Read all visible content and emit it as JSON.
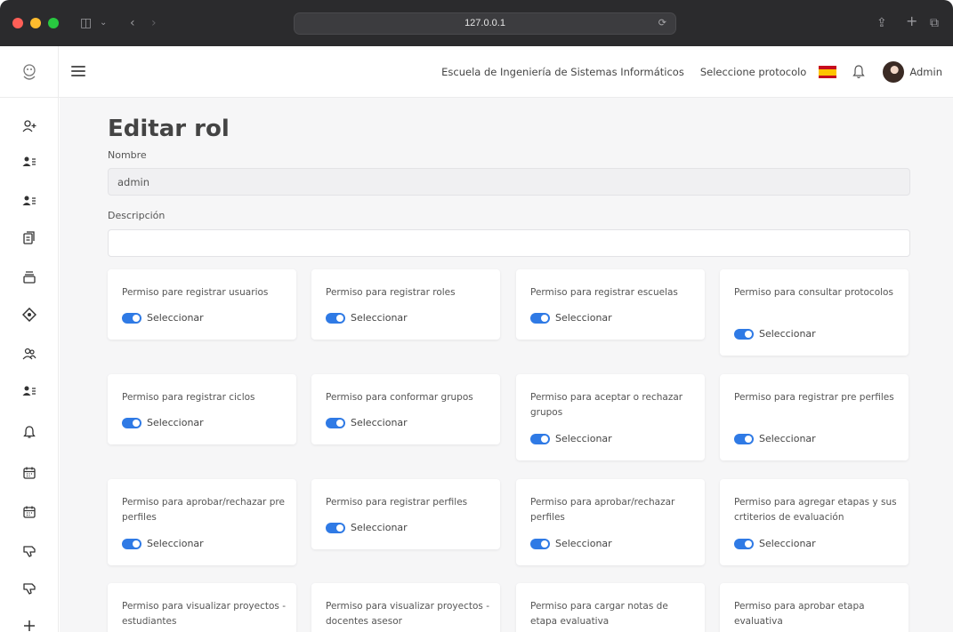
{
  "browser": {
    "url": "127.0.0.1"
  },
  "header": {
    "school": "Escuela de Ingeniería de Sistemas Informáticos",
    "protocol": "Seleccione protocolo",
    "user": "Admin"
  },
  "sidebar": {
    "icons": [
      "add-user-icon",
      "user-list-icon",
      "user-list-icon",
      "document-icon",
      "box-icon",
      "diamond-icon",
      "users-icon",
      "user-list-icon",
      "bell-icon",
      "calendar-icon",
      "calendar-icon",
      "thumb-down-icon",
      "thumb-down-icon",
      "plus-icon"
    ]
  },
  "form": {
    "title": "Editar rol",
    "name_label": "Nombre",
    "name_value": "admin",
    "description_label": "Descripción",
    "description_value": ""
  },
  "permissions": [
    {
      "label": "Permiso pare registrar usuarios",
      "toggle": "Seleccionar"
    },
    {
      "label": "Permiso para registrar roles",
      "toggle": "Seleccionar"
    },
    {
      "label": "Permiso para registrar escuelas",
      "toggle": "Seleccionar"
    },
    {
      "label": "Permiso para consultar protocolos",
      "toggle": "Seleccionar"
    },
    {
      "label": "Permiso para registrar ciclos",
      "toggle": "Seleccionar"
    },
    {
      "label": "Permiso para conformar grupos",
      "toggle": "Seleccionar"
    },
    {
      "label": "Permiso para aceptar o rechazar grupos",
      "toggle": "Seleccionar"
    },
    {
      "label": "Permiso para registrar pre perfiles",
      "toggle": "Seleccionar"
    },
    {
      "label": "Permiso para aprobar/rechazar pre perfiles",
      "toggle": "Seleccionar"
    },
    {
      "label": "Permiso para registrar perfiles",
      "toggle": "Seleccionar"
    },
    {
      "label": "Permiso para aprobar/rechazar perfiles",
      "toggle": "Seleccionar"
    },
    {
      "label": "Permiso para agregar etapas y sus crtiterios de evaluación",
      "toggle": "Seleccionar"
    },
    {
      "label": "Permiso para visualizar proyectos - estudiantes",
      "toggle": ""
    },
    {
      "label": "Permiso para visualizar proyectos - docentes asesor",
      "toggle": ""
    },
    {
      "label": "Permiso para cargar notas de etapa evaluativa",
      "toggle": ""
    },
    {
      "label": "Permiso para aprobar etapa evaluativa",
      "toggle": ""
    }
  ],
  "colors": {
    "accent": "#2f7ae5",
    "background": "#f6f6f7"
  }
}
